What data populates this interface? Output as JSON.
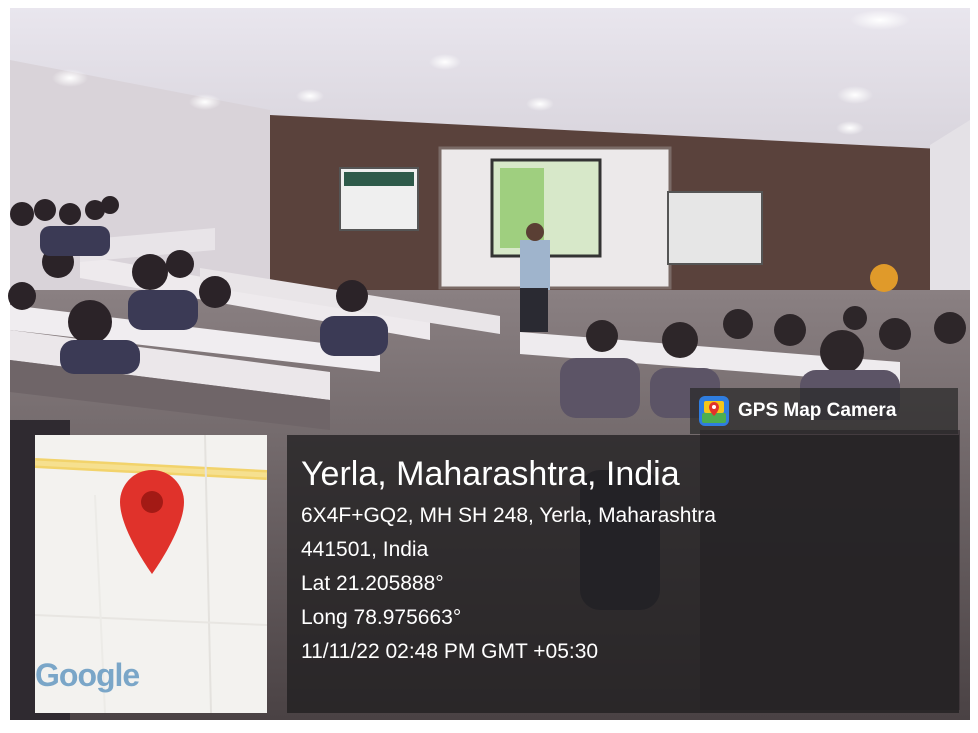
{
  "watermark": {
    "app_name": "GPS Map Camera",
    "icon": "gps-map-camera-app-icon"
  },
  "map": {
    "brand": "Google",
    "pin_icon": "map-pin-icon",
    "pin_color": "#e0322b"
  },
  "location": {
    "title": "Yerla, Maharashtra, India",
    "address_line_1": "6X4F+GQ2, MH SH 248, Yerla, Maharashtra",
    "address_line_2": "441501, India",
    "latitude": "Lat 21.205888°",
    "longitude": "Long 78.975663°",
    "timestamp": "11/11/22 02:48 PM GMT +05:30"
  }
}
